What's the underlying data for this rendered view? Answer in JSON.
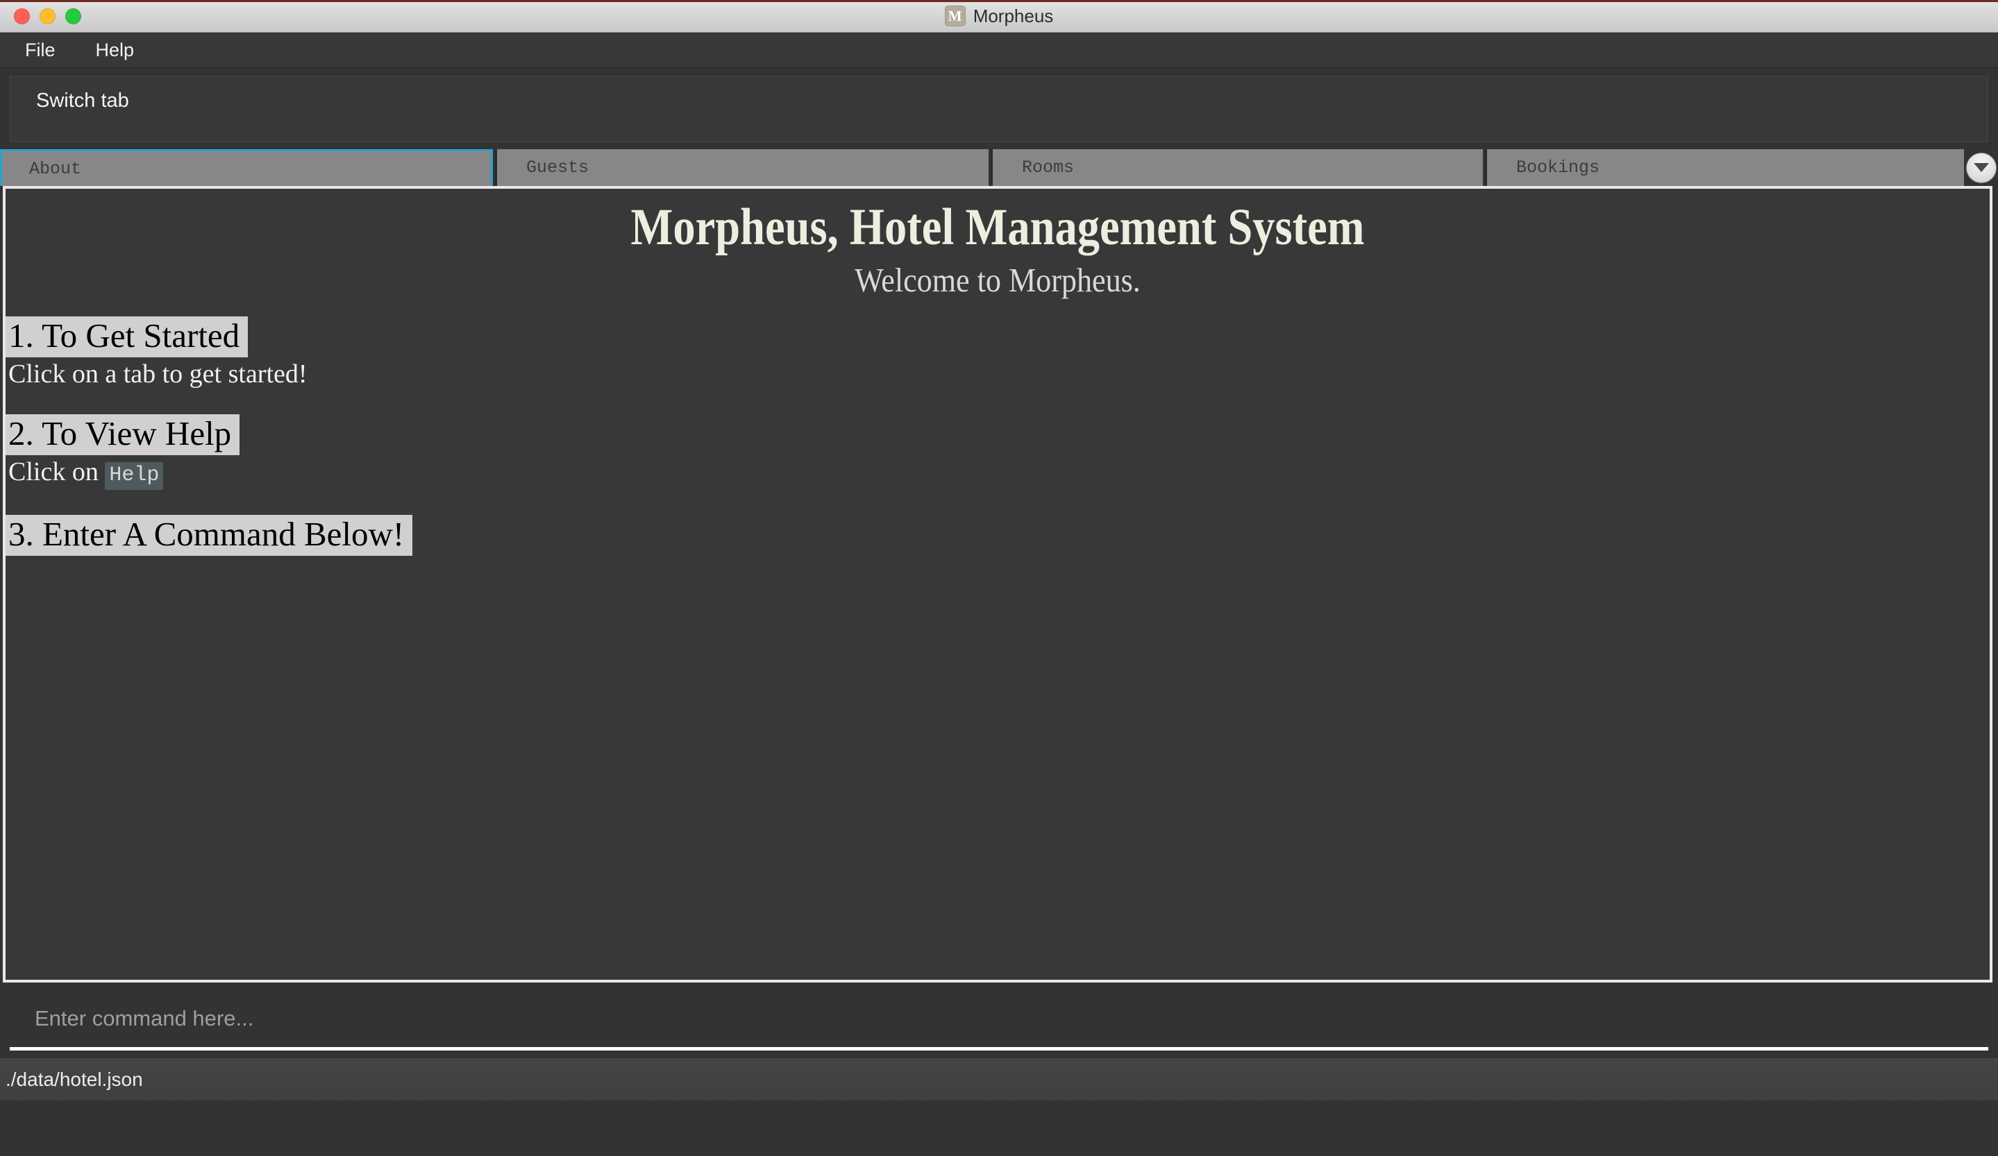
{
  "window": {
    "title": "Morpheus",
    "app_icon_letter": "M",
    "traffic_lights": [
      {
        "name": "close",
        "color": "#ff5f56"
      },
      {
        "name": "minimize",
        "color": "#ffbd2e"
      },
      {
        "name": "maximize",
        "color": "#27c93f"
      }
    ]
  },
  "menubar": {
    "items": [
      {
        "label": "File"
      },
      {
        "label": "Help"
      }
    ]
  },
  "switch_panel": {
    "label": "Switch tab"
  },
  "tabs": {
    "items": [
      {
        "label": "About",
        "active": true
      },
      {
        "label": "Guests",
        "active": false
      },
      {
        "label": "Rooms",
        "active": false
      },
      {
        "label": "Bookings",
        "active": false
      }
    ],
    "overflow_icon": "chevron-down-icon",
    "active_border_color": "#2aa3d0",
    "tab_background": "#878787"
  },
  "content": {
    "title": "Morpheus, Hotel Management System",
    "subtitle": "Welcome to Morpheus.",
    "sections": [
      {
        "heading": "1. To Get Started",
        "body": "Click on a tab to get started!"
      },
      {
        "heading": "2. To View Help",
        "body_prefix": "Click on ",
        "body_code": "Help"
      },
      {
        "heading": "3. Enter A Command Below!"
      }
    ],
    "title_color": "#edeee0",
    "heading_background": "#d0d0d0"
  },
  "command_bar": {
    "value": "",
    "placeholder": "Enter command here..."
  },
  "status_bar": {
    "text": "./data/hotel.json"
  }
}
